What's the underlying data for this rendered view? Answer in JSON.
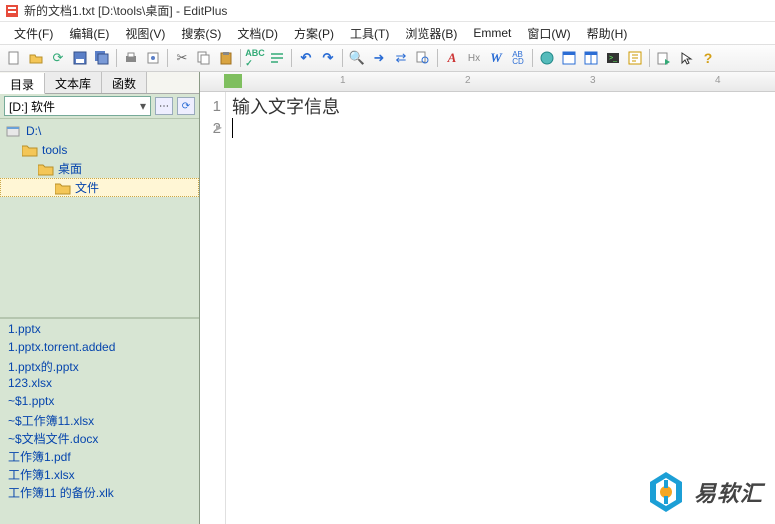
{
  "title": "新的文档1.txt [D:\\tools\\桌面] - EditPlus",
  "menu": {
    "file": "文件(F)",
    "edit": "编辑(E)",
    "view": "视图(V)",
    "search": "搜索(S)",
    "doc": "文档(D)",
    "project": "方案(P)",
    "tools": "工具(T)",
    "browser": "浏览器(B)",
    "emmet": "Emmet",
    "window": "窗口(W)",
    "help": "帮助(H)"
  },
  "sidebar": {
    "tabs": {
      "dir": "目录",
      "textlib": "文本库",
      "func": "函数"
    },
    "drive": "[D:] 软件",
    "tree": [
      {
        "label": "D:\\",
        "level": 0
      },
      {
        "label": "tools",
        "level": 1
      },
      {
        "label": "桌面",
        "level": 2
      },
      {
        "label": "文件",
        "level": 3,
        "selected": true
      }
    ],
    "files": [
      "1.pptx",
      "1.pptx.torrent.added",
      "1.pptx的.pptx",
      "123.xlsx",
      "~$1.pptx",
      "~$工作簿11.xlsx",
      "~$文档文件.docx",
      "工作簿1.pdf",
      "工作簿1.xlsx",
      "工作簿11 的备份.xlk"
    ]
  },
  "ruler": {
    "marks": [
      "1",
      "2",
      "3",
      "4"
    ]
  },
  "editor": {
    "lines": [
      {
        "num": "1",
        "text": "输入文字信息"
      },
      {
        "num": "2",
        "text": ""
      }
    ]
  },
  "watermark": "易软汇"
}
